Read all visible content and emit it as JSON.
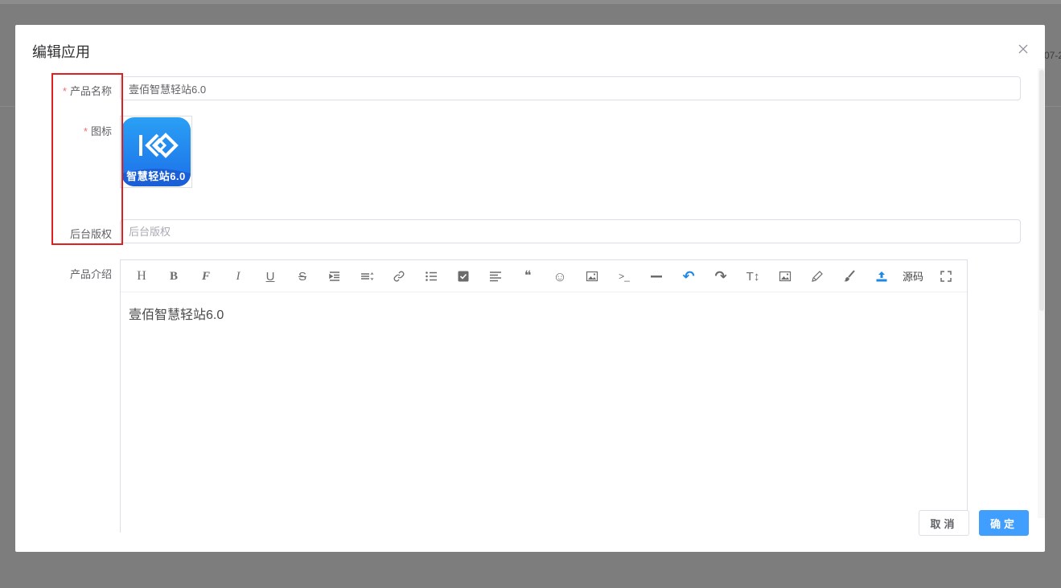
{
  "background": {
    "partial_text": "07-2"
  },
  "dialog": {
    "title": "编辑应用"
  },
  "form": {
    "product_name": {
      "label": "产品名称",
      "required_mark": "*",
      "value": "壹佰智慧轻站6.0"
    },
    "icon": {
      "label": "图标",
      "required_mark": "*",
      "logo_text": "智慧轻站6.0"
    },
    "copyright": {
      "label": "后台版权",
      "value": "",
      "placeholder": "后台版权"
    },
    "intro": {
      "label": "产品介绍",
      "content": "壹佰智慧轻站6.0"
    }
  },
  "editor": {
    "toolbar": [
      {
        "icon": "heading-icon",
        "glyph": "H"
      },
      {
        "icon": "bold-icon",
        "glyph": "B"
      },
      {
        "icon": "font-icon",
        "glyph": "F"
      },
      {
        "icon": "italic-icon",
        "glyph": "I"
      },
      {
        "icon": "underline-icon",
        "glyph": "U"
      },
      {
        "icon": "strikethrough-icon",
        "glyph": "S"
      },
      {
        "icon": "indent-icon",
        "glyph": ""
      },
      {
        "icon": "line-height-icon",
        "glyph": ""
      },
      {
        "icon": "link-icon",
        "glyph": ""
      },
      {
        "icon": "unordered-list-icon",
        "glyph": ""
      },
      {
        "icon": "checkbox-icon",
        "glyph": ""
      },
      {
        "icon": "align-left-icon",
        "glyph": ""
      },
      {
        "icon": "quote-icon",
        "glyph": "❝"
      },
      {
        "icon": "emoji-icon",
        "glyph": "☺"
      },
      {
        "icon": "image-icon",
        "glyph": ""
      },
      {
        "icon": "code-icon",
        "glyph": ">_"
      },
      {
        "icon": "divider-icon",
        "glyph": ""
      },
      {
        "icon": "undo-icon",
        "glyph": "↶"
      },
      {
        "icon": "redo-icon",
        "glyph": "↷"
      },
      {
        "icon": "text-size-icon",
        "glyph": "T↕"
      },
      {
        "icon": "image-icon-2",
        "glyph": ""
      },
      {
        "icon": "pencil-icon",
        "glyph": ""
      },
      {
        "icon": "brush-icon",
        "glyph": ""
      },
      {
        "icon": "upload-icon",
        "glyph": ""
      },
      {
        "icon": "source-code-button",
        "glyph": "源码"
      },
      {
        "icon": "fullscreen-icon",
        "glyph": ""
      }
    ]
  },
  "buttons": {
    "cancel": "取消",
    "confirm": "确定"
  },
  "colors": {
    "primary": "#409eff",
    "required": "#f56c6c",
    "highlight": "#e02020",
    "overlay": "#7d7d7d",
    "undo_active": "#1e88e5"
  }
}
